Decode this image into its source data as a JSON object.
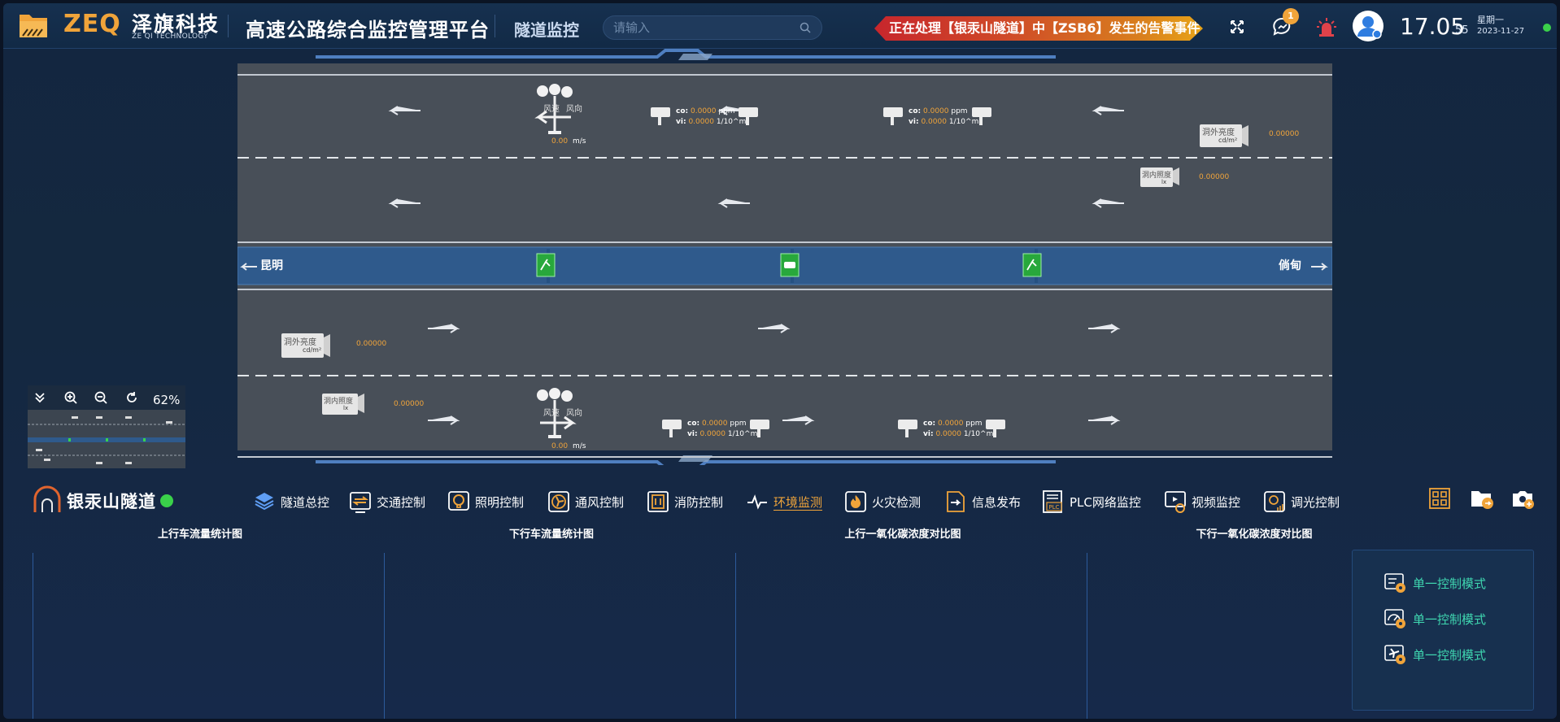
{
  "header": {
    "brand_en": "ZEQ",
    "brand_cn": "泽旗科技",
    "brand_sub": "ZE QI TECHNOLOGY",
    "platform_title": "高速公路综合监控管理平台",
    "module_title": "隧道监控",
    "search_placeholder": "请输入",
    "alert_text": "正在处理【银汞山隧道】中【ZSB6】发生的告警事件",
    "message_count": "1",
    "time": "17.05",
    "seconds": "55",
    "weekday": "星期一",
    "date": "2023-11-27"
  },
  "tunnel": {
    "left_dest": "昆明",
    "right_dest": "倘甸",
    "wind_label": "风速",
    "direction_label": "风向",
    "wind_value": "0.00",
    "wind_unit": "m/s",
    "co_label": "co:",
    "vi_label": "vi:",
    "co_value": "0.0000",
    "co_unit": "ppm",
    "vi_value": "0.0000",
    "vi_unit": "1/10^m",
    "lum_out_label": "洞外亮度",
    "lum_out_unit": "cd/m²",
    "lum_in_label": "洞内照度",
    "lum_in_unit": "lx",
    "lum_value": "0.00000"
  },
  "minimap": {
    "zoom": "62%"
  },
  "tunnel_info": {
    "name": "银汞山隧道",
    "status_color": "#3ad14a"
  },
  "nav": [
    {
      "label": "隧道总控",
      "icon": "layers-icon"
    },
    {
      "label": "交通控制",
      "icon": "traffic-icon"
    },
    {
      "label": "照明控制",
      "icon": "bulb-icon"
    },
    {
      "label": "通风控制",
      "icon": "fan-icon"
    },
    {
      "label": "消防控制",
      "icon": "fire-cabinet-icon"
    },
    {
      "label": "环境监测",
      "icon": "pulse-icon",
      "active": true
    },
    {
      "label": "火灾检测",
      "icon": "flame-icon"
    },
    {
      "label": "信息发布",
      "icon": "publish-icon"
    },
    {
      "label": "PLC网络监控",
      "icon": "plc-icon"
    },
    {
      "label": "视频监控",
      "icon": "video-icon"
    },
    {
      "label": "调光控制",
      "icon": "dimmer-icon"
    }
  ],
  "panels": {
    "up_flow": "上行车流量统计图",
    "down_flow": "下行车流量统计图",
    "up_co": "上行一氧化碳浓度对比图",
    "down_co": "下行一氧化碳浓度对比图"
  },
  "control_modes": [
    "单一控制模式",
    "单一控制模式",
    "单一控制模式"
  ],
  "colors": {
    "accent": "#f0a43a",
    "active_green": "#3ad14a",
    "mode_text": "#3fd6b0",
    "alert_red": "#c7262c"
  }
}
